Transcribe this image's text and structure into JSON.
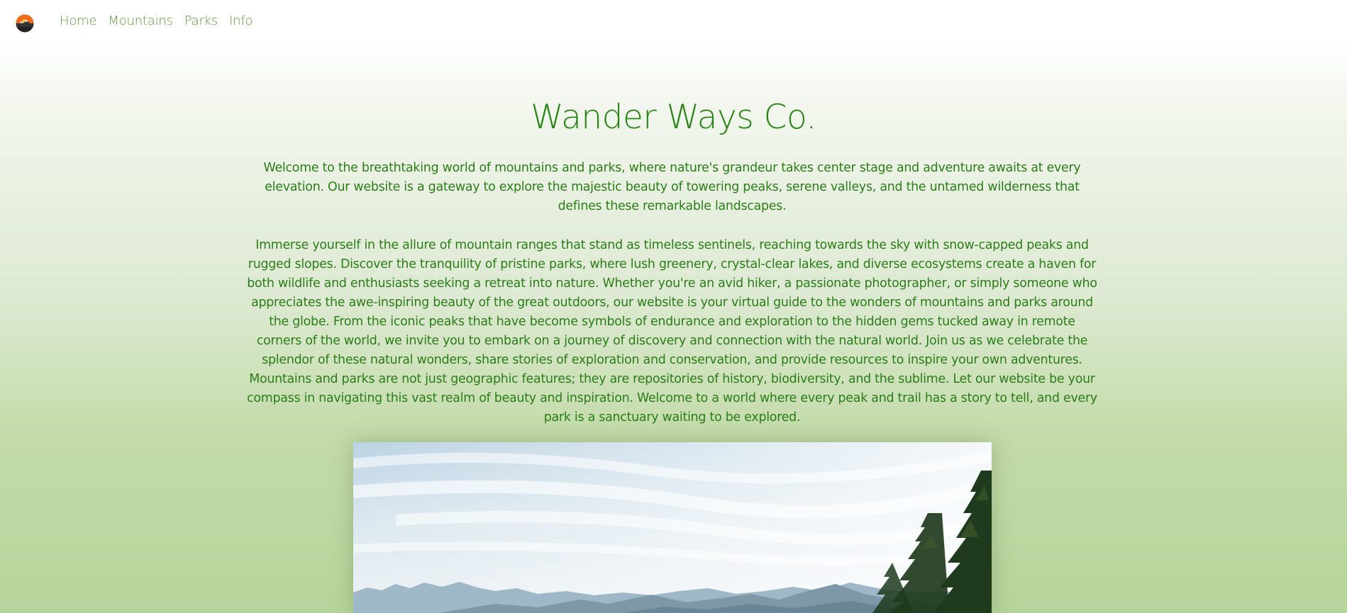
{
  "nav": {
    "logo_icon": "mountain-sun-logo-icon",
    "links": [
      "Home",
      "Mountains",
      "Parks",
      "Info"
    ]
  },
  "main": {
    "title": "Wander Ways Co.",
    "intro": "Welcome to the breathtaking world of mountains and parks, where nature's grandeur takes center stage and adventure awaits at every elevation. Our website is a gateway to explore the majestic beauty of towering peaks, serene valleys, and the untamed wilderness that defines these remarkable landscapes.",
    "body": "Immerse yourself in the allure of mountain ranges that stand as timeless sentinels, reaching towards the sky with snow-capped peaks and rugged slopes. Discover the tranquility of pristine parks, where lush greenery, crystal-clear lakes, and diverse ecosystems create a haven for both wildlife and enthusiasts seeking a retreat into nature. Whether you're an avid hiker, a passionate photographer, or simply someone who appreciates the awe-inspiring beauty of the great outdoors, our website is your virtual guide to the wonders of mountains and parks around the globe. From the iconic peaks that have become symbols of endurance and exploration to the hidden gems tucked away in remote corners of the world, we invite you to embark on a journey of discovery and connection with the natural world. Join us as we celebrate the splendor of these natural wonders, share stories of exploration and conservation, and provide resources to inspire your own adventures. Mountains and parks are not just geographic features; they are repositories of history, biodiversity, and the sublime. Let our website be your compass in navigating this vast realm of beauty and inspiration. Welcome to a world where every peak and trail has a story to tell, and every park is a sanctuary waiting to be explored."
  },
  "colors": {
    "accent_green": "#2b8416",
    "nav_green": "#5e9a3c"
  }
}
